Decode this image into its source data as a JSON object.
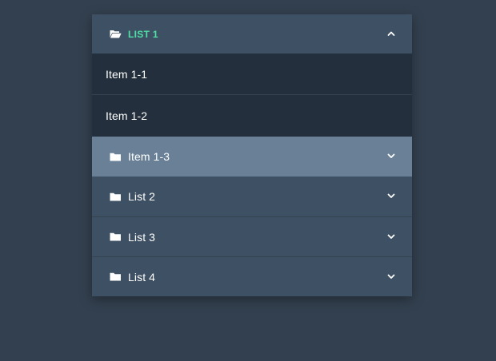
{
  "accordion": {
    "open_list": {
      "label": "LIST 1",
      "icon": "open-folder-icon",
      "expanded": true,
      "accent_color": "#4fe0a5"
    },
    "sub_items": [
      {
        "label": "Item 1-1"
      },
      {
        "label": "Item 1-2"
      }
    ],
    "highlighted_item": {
      "label": "Item 1-3",
      "icon": "folder-icon"
    },
    "lists": [
      {
        "label": "List 2",
        "icon": "folder-icon"
      },
      {
        "label": "List 3",
        "icon": "folder-icon"
      },
      {
        "label": "List 4",
        "icon": "folder-icon"
      }
    ]
  },
  "colors": {
    "background": "#33404f",
    "header": "#3e5064",
    "sub_item": "#232f3c",
    "highlight": "#6a8096"
  }
}
